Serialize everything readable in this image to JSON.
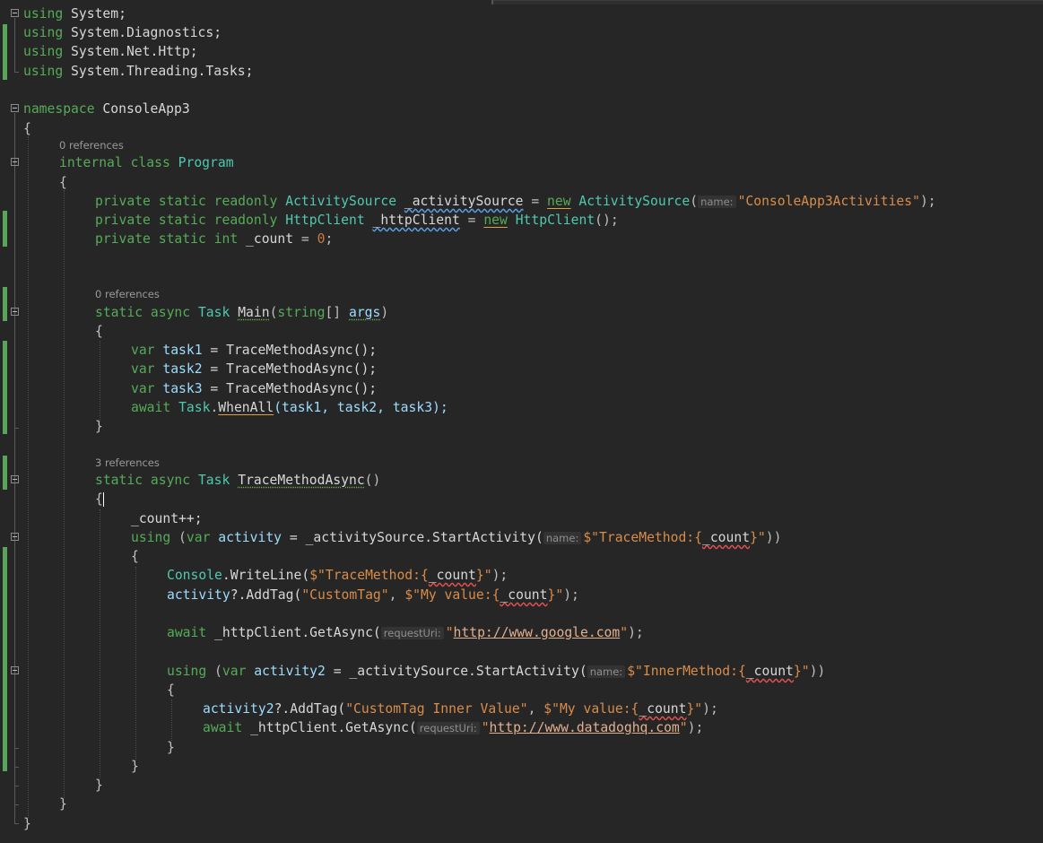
{
  "editor": {
    "lens": {
      "program_refs": "0 references",
      "main_refs": "0 references",
      "trace_refs": "3 references"
    },
    "hints": {
      "name": "name:",
      "request_uri": "requestUri:"
    },
    "code": {
      "l1": {
        "a": "using",
        "b": " System;"
      },
      "l2": {
        "a": "using",
        "b": " System.Diagnostics;"
      },
      "l3": {
        "a": "using",
        "b": " System.Net.Http;"
      },
      "l4": {
        "a": "using",
        "b": " System.Threading.Tasks;"
      },
      "l6": {
        "a": "namespace",
        "b": " ConsoleApp3"
      },
      "l7": {
        "a": "{"
      },
      "l8": {
        "a": "internal",
        "b": " class ",
        "c": "Program"
      },
      "l9": {
        "a": "{"
      },
      "l10": {
        "a": "private static readonly ",
        "b": "ActivitySource",
        "c": " ",
        "d": "_activitySource",
        "e": " = ",
        "f": "new",
        "g": " ",
        "h": "ActivitySource",
        "i": "(",
        "j": "\"ConsoleApp3Activities\"",
        "k": ");"
      },
      "l11": {
        "a": "private static readonly ",
        "b": "HttpClient",
        "c": " ",
        "d": "_httpClient",
        "e": " = ",
        "f": "new",
        "g": " ",
        "h": "HttpClient",
        "i": "();"
      },
      "l12": {
        "a": "private static int ",
        "b": "_count",
        "c": " = ",
        "d": "0",
        "e": ";"
      },
      "l15": {
        "a": "static async ",
        "b": "Task",
        "c": " ",
        "d": "Main",
        "e": "(",
        "f": "string",
        "g": "[] ",
        "h": "args",
        "i": ")"
      },
      "l16": {
        "a": "{"
      },
      "l17": {
        "a": "var",
        "b": " task1",
        "c": " = TraceMethodAsync();"
      },
      "l18": {
        "a": "var",
        "b": " task2",
        "c": " = TraceMethodAsync();"
      },
      "l19": {
        "a": "var",
        "b": " task3",
        "c": " = TraceMethodAsync();"
      },
      "l20": {
        "a": "await ",
        "b": "Task",
        "c": ".",
        "d": "WhenAll",
        "e": "(task1, task2, task3);"
      },
      "l21": {
        "a": "}"
      },
      "l23": {
        "a": "static async ",
        "b": "Task",
        "c": " ",
        "d": "TraceMethodAsync",
        "e": "()"
      },
      "l24": {
        "a": "{"
      },
      "l25": {
        "a": "_count++;"
      },
      "l26": {
        "a": "using",
        "b": " (",
        "c": "var",
        "d": " activity",
        "e": " = _activitySource.StartActivity(",
        "f": "$\"TraceMethod:{",
        "g": "_count",
        "h": "}\"",
        "i": "))"
      },
      "l27": {
        "a": "{"
      },
      "l28": {
        "a": "Console",
        "b": ".WriteLine(",
        "c": "$\"TraceMethod:{",
        "d": "_count",
        "e": "}\"",
        "f": ");"
      },
      "l29": {
        "a": "activity",
        "b": "?.AddTag(",
        "c": "\"CustomTag\"",
        "d": ", ",
        "e": "$\"My value:{",
        "f": "_count",
        "g": "}\"",
        "h": ");"
      },
      "l31": {
        "a": "await ",
        "b": "_httpClient.GetAsync(",
        "c": "\"",
        "d": "http://www.google.com",
        "e": "\"",
        "f": ");"
      },
      "l33": {
        "a": "using",
        "b": " (",
        "c": "var",
        "d": " activity2",
        "e": " = _activitySource.StartActivity(",
        "f": "$\"InnerMethod:{",
        "g": "_count",
        "h": "}\"",
        "i": "))"
      },
      "l34": {
        "a": "{"
      },
      "l35": {
        "a": "activity2",
        "b": "?.AddTag(",
        "c": "\"CustomTag Inner Value\"",
        "d": ", ",
        "e": "$\"My value:{",
        "f": "_count",
        "g": "}\"",
        "h": ");"
      },
      "l36": {
        "a": "await ",
        "b": "_httpClient.GetAsync(",
        "c": "\"",
        "d": "http://www.datadoghq.com",
        "e": "\"",
        "f": ");"
      },
      "l37": {
        "a": "}"
      },
      "l38": {
        "a": "}"
      },
      "l39": {
        "a": "}"
      },
      "l40": {
        "a": "}"
      },
      "l41": {
        "a": "}"
      }
    }
  }
}
